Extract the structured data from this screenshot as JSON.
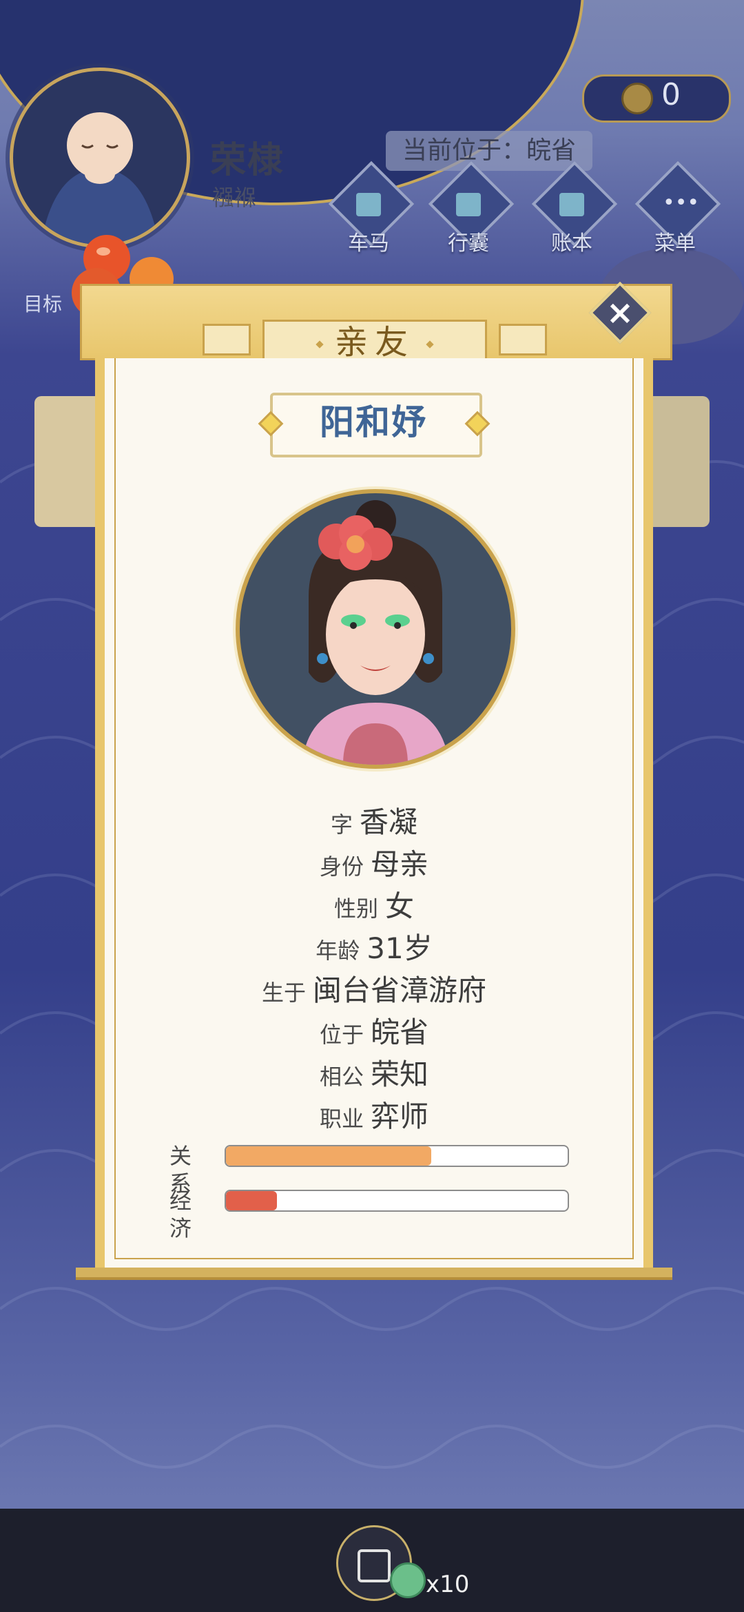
{
  "player": {
    "name": "荣棣",
    "stage": "襁褓",
    "location_text": "当前位于：皖省"
  },
  "currency": {
    "value": "0",
    "icon": "coin-icon"
  },
  "nav": [
    {
      "label": "车马",
      "icon": "carriage-icon"
    },
    {
      "label": "行囊",
      "icon": "bag-icon"
    },
    {
      "label": "账本",
      "icon": "ledger-icon"
    },
    {
      "label": "菜单",
      "icon": "menu-icon"
    }
  ],
  "goal_label": "目标",
  "dialog": {
    "title": "亲友",
    "person_name": "阳和妤",
    "fields": [
      {
        "key": "字",
        "value": "香凝"
      },
      {
        "key": "身份",
        "value": "母亲"
      },
      {
        "key": "性别",
        "value": "女"
      },
      {
        "key": "年龄",
        "value": "31岁"
      },
      {
        "key": "生于",
        "value": "闽台省漳游府"
      },
      {
        "key": "位于",
        "value": "皖省"
      },
      {
        "key": "相公",
        "value": "荣知"
      },
      {
        "key": "职业",
        "value": "弈师"
      }
    ],
    "bars": [
      {
        "key": "关系",
        "level": 0.6,
        "color": "#f2a964"
      },
      {
        "key": "经济",
        "level": 0.15,
        "color": "#e2604a"
      }
    ]
  },
  "bottom": {
    "multiplier": "x10"
  }
}
